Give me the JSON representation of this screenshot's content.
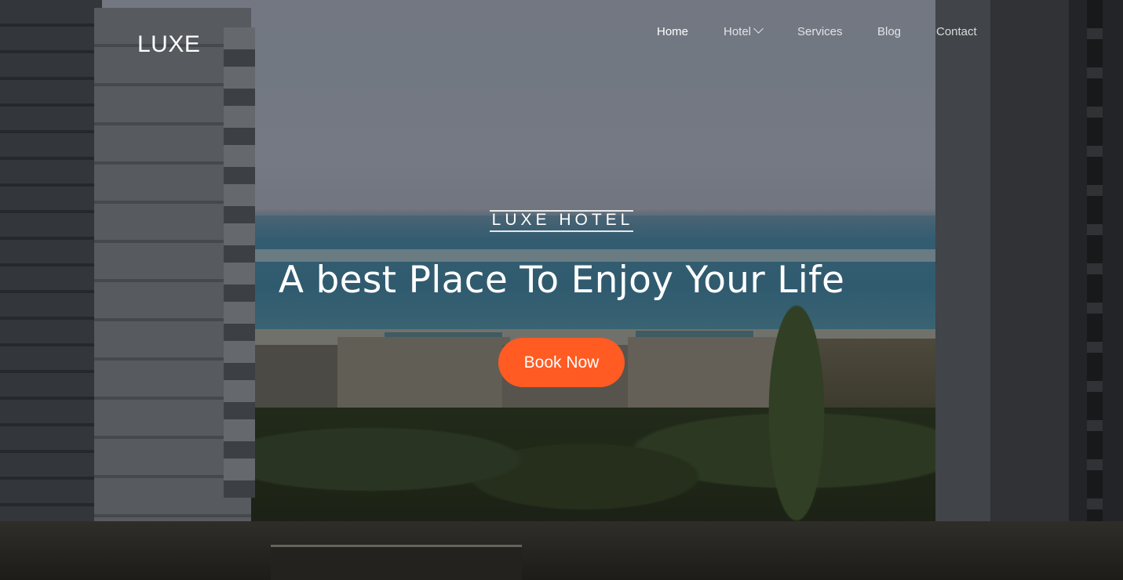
{
  "brand": {
    "logo": "LUXE"
  },
  "nav": {
    "items": [
      {
        "label": "Home",
        "active": true
      },
      {
        "label": "Hotel",
        "has_dropdown": true
      },
      {
        "label": "Services"
      },
      {
        "label": "Blog"
      },
      {
        "label": "Contact"
      }
    ]
  },
  "hero": {
    "eyebrow": "LUXE HOTEL",
    "headline": "A best Place To Enjoy Your Life",
    "cta_label": "Book Now"
  },
  "colors": {
    "accent": "#ff5b22",
    "text": "#ffffff"
  },
  "icons": {
    "dropdown": "chevron-down-icon"
  }
}
